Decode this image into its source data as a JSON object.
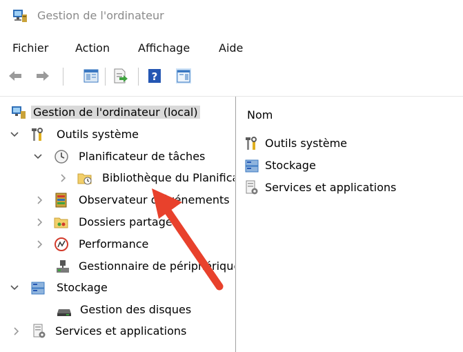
{
  "window": {
    "title": "Gestion de l'ordinateur",
    "icon": "computer-management-icon"
  },
  "menu": {
    "items": [
      "Fichier",
      "Action",
      "Affichage",
      "Aide"
    ]
  },
  "toolbar": {
    "buttons": [
      "back-arrow-icon",
      "forward-arrow-icon",
      "show-hide-tree-icon",
      "export-list-icon",
      "help-icon",
      "show-hide-action-pane-icon"
    ]
  },
  "tree": {
    "root": "Gestion de l'ordinateur (local)",
    "system_tools": "Outils système",
    "task_scheduler": "Planificateur de tâches",
    "scheduler_library": "Bibliothèque du Planificateur de tâches",
    "event_viewer": "Observateur d'événements",
    "shared_folders": "Dossiers partagés",
    "performance": "Performance",
    "device_manager": "Gestionnaire de périphériques",
    "storage": "Stockage",
    "disk_management": "Gestion des disques",
    "services_apps": "Services et applications"
  },
  "list": {
    "header": "Nom",
    "items": [
      "Outils système",
      "Stockage",
      "Services et applications"
    ]
  },
  "colors": {
    "arrow": "#e8412c",
    "selection": "#d9d9d9",
    "pane_divider": "#a0a0a0"
  }
}
